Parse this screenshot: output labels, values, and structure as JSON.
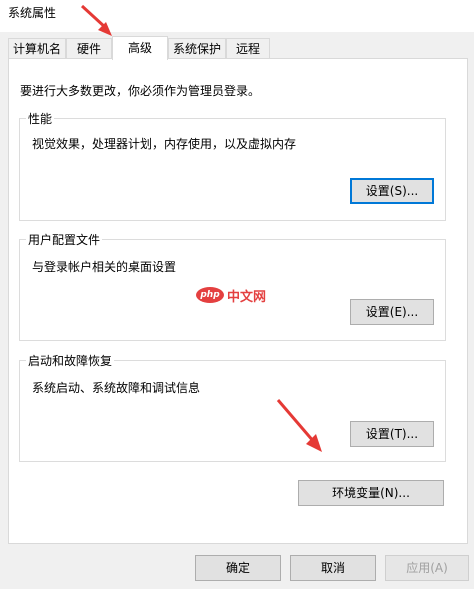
{
  "window": {
    "title": "系统属性"
  },
  "tabs": [
    {
      "label": "计算机名"
    },
    {
      "label": "硬件"
    },
    {
      "label": "高级"
    },
    {
      "label": "系统保护"
    },
    {
      "label": "远程"
    }
  ],
  "notice": "要进行大多数更改，你必须作为管理员登录。",
  "groups": {
    "performance": {
      "title": "性能",
      "desc": "视觉效果，处理器计划，内存使用，以及虚拟内存",
      "button": "设置(S)..."
    },
    "profiles": {
      "title": "用户配置文件",
      "desc": "与登录帐户相关的桌面设置",
      "button": "设置(E)..."
    },
    "startup": {
      "title": "启动和故障恢复",
      "desc": "系统启动、系统故障和调试信息",
      "button": "设置(T)..."
    }
  },
  "env_button": "环境变量(N)...",
  "footer": {
    "ok": "确定",
    "cancel": "取消",
    "apply": "应用(A)"
  },
  "watermark": {
    "logo": "php",
    "text": "中文网"
  },
  "colors": {
    "arrow": "#e53935",
    "focus": "#0078d7"
  }
}
